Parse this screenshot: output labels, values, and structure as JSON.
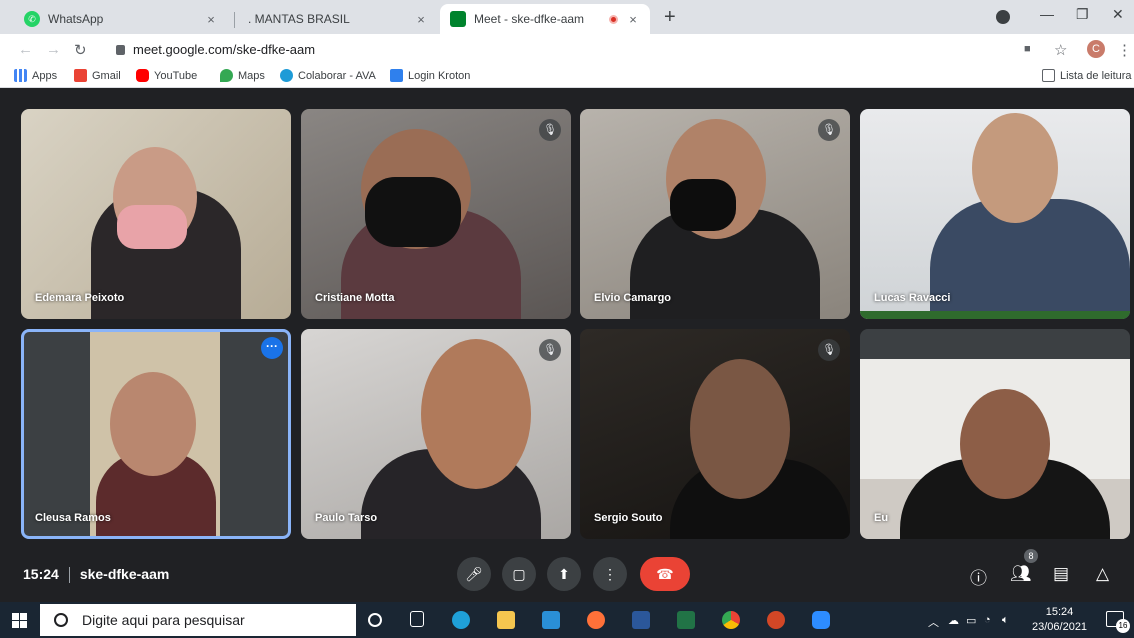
{
  "browser": {
    "tabs": [
      {
        "title": "WhatsApp",
        "close": "×"
      },
      {
        "title": ". MANTAS BRASIL",
        "close": "×"
      },
      {
        "title": "Meet - ske-dfke-aam",
        "close": "×"
      }
    ],
    "new_tab": "+",
    "url": "meet.google.com/ske-dfke-aam",
    "profile_initial": "C",
    "bookmarks": [
      "Apps",
      "Gmail",
      "YouTube",
      "Maps",
      "Colaborar - AVA",
      "Login Kroton"
    ],
    "reading_list": "Lista de leitura"
  },
  "meet": {
    "participants": [
      {
        "name": "Edemara Peixoto",
        "muted": false
      },
      {
        "name": "Cristiane Motta",
        "muted": true
      },
      {
        "name": "Elvio Camargo",
        "muted": true
      },
      {
        "name": "Lucas Ravacci",
        "muted": false
      },
      {
        "name": "Cleusa Ramos",
        "muted": false,
        "speaking": true
      },
      {
        "name": "Paulo Tarso",
        "muted": true
      },
      {
        "name": "Sergio Souto",
        "muted": true
      },
      {
        "name": "Eu",
        "muted": false
      }
    ],
    "time": "15:24",
    "meeting_code": "ske-dfke-aam",
    "participant_count": "8",
    "colors": {
      "end_call": "#ea4335",
      "speaking_outline": "#8ab4f8",
      "more_options": "#1a73e8"
    }
  },
  "taskbar": {
    "search_placeholder": "Digite aqui para pesquisar",
    "clock_time": "15:24",
    "clock_date": "23/06/2021",
    "notifications": "16"
  }
}
